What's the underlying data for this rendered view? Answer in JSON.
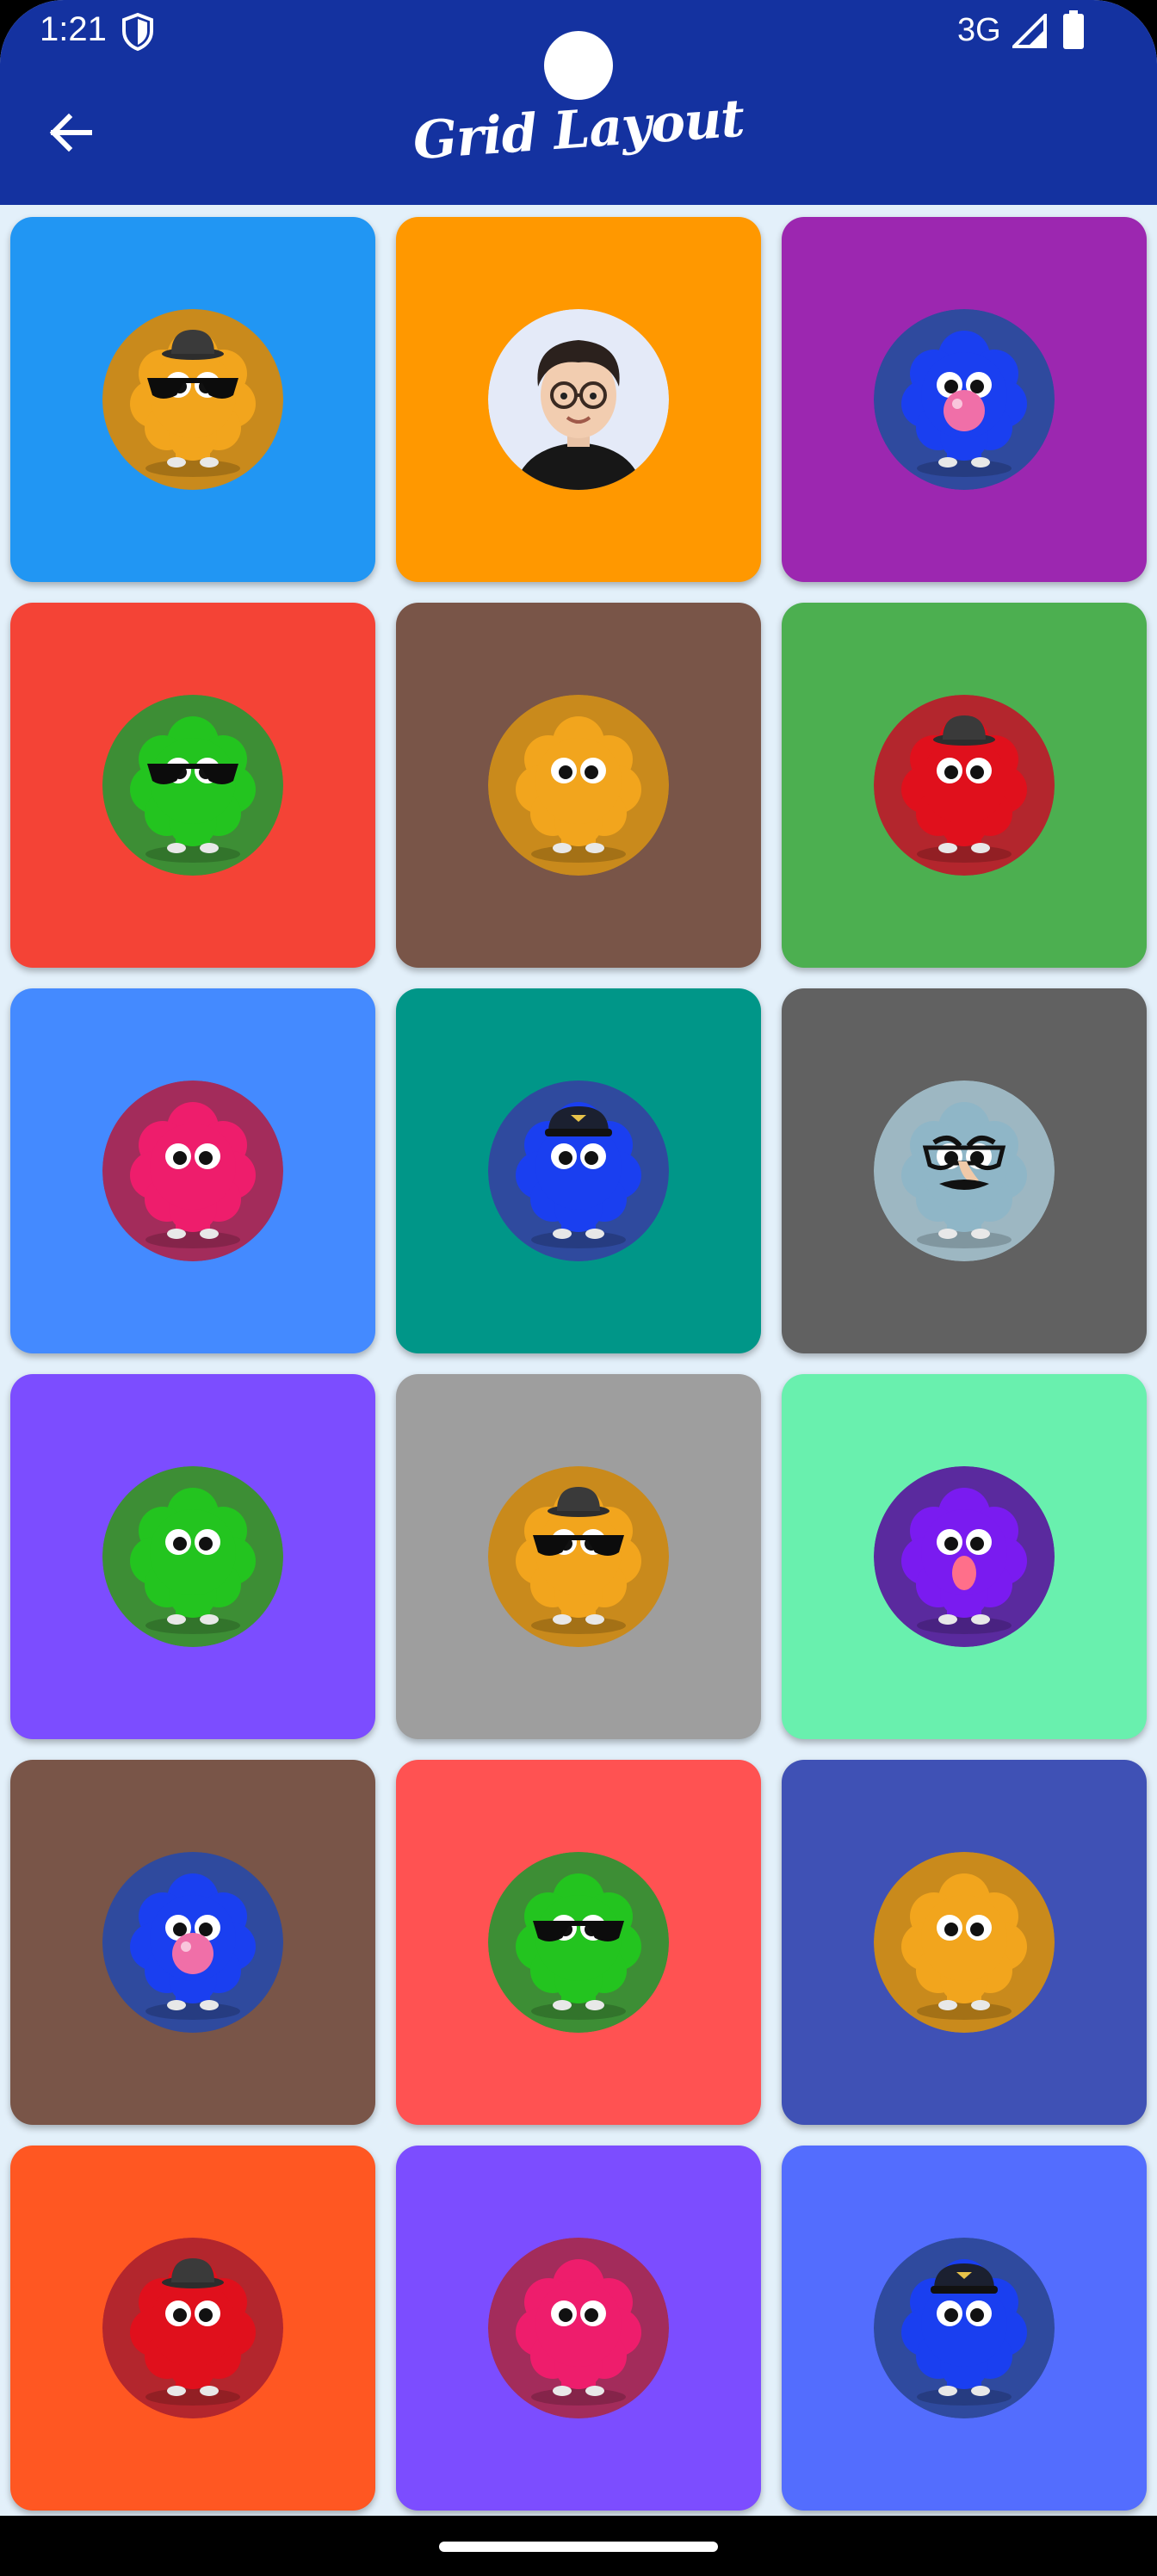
{
  "status_bar": {
    "time": "1:21",
    "network": "3G"
  },
  "app_bar": {
    "title": "Grid Layout"
  },
  "colors": {
    "app_bar": "#1432a0",
    "background": "#e3f0fa"
  },
  "grid": {
    "columns": 3,
    "cards": [
      {
        "bg": "#2196f3",
        "avatar": "monster",
        "fur": "#f2a51d",
        "skin": "#c98a1c",
        "accessory": "hat-glasses"
      },
      {
        "bg": "#ff9800",
        "avatar": "person",
        "fur": "#2b211d",
        "skin": "#e4eaf8",
        "accessory": "glasses"
      },
      {
        "bg": "#9c27b0",
        "avatar": "monster",
        "fur": "#1a3ff0",
        "skin": "#2f4a9e",
        "accessory": "bubblegum"
      },
      {
        "bg": "#f44336",
        "avatar": "monster",
        "fur": "#23c41f",
        "skin": "#3d8e35",
        "accessory": "glasses"
      },
      {
        "bg": "#795548",
        "avatar": "monster",
        "fur": "#f2a51d",
        "skin": "#c98a1c",
        "accessory": "none"
      },
      {
        "bg": "#4caf50",
        "avatar": "monster",
        "fur": "#e0101c",
        "skin": "#b3262d",
        "accessory": "hat"
      },
      {
        "bg": "#448aff",
        "avatar": "monster",
        "fur": "#ee1d6c",
        "skin": "#a32c5b",
        "accessory": "none"
      },
      {
        "bg": "#009688",
        "avatar": "monster",
        "fur": "#1a3ff0",
        "skin": "#2f4a9e",
        "accessory": "cap"
      },
      {
        "bg": "#616161",
        "avatar": "monster",
        "fur": "#8fb6c7",
        "skin": "#9db7c2",
        "accessory": "disguise"
      },
      {
        "bg": "#7c4dff",
        "avatar": "monster",
        "fur": "#23c41f",
        "skin": "#3d8e35",
        "accessory": "none"
      },
      {
        "bg": "#9e9e9e",
        "avatar": "monster",
        "fur": "#f2a51d",
        "skin": "#c98a1c",
        "accessory": "hat-glasses"
      },
      {
        "bg": "#69f0ae",
        "avatar": "monster",
        "fur": "#7a1bf0",
        "skin": "#5a2a9e",
        "accessory": "tongue"
      },
      {
        "bg": "#795548",
        "avatar": "monster",
        "fur": "#1a3ff0",
        "skin": "#2f4a9e",
        "accessory": "bubblegum"
      },
      {
        "bg": "#ff5252",
        "avatar": "monster",
        "fur": "#23c41f",
        "skin": "#3d8e35",
        "accessory": "glasses"
      },
      {
        "bg": "#3f51b5",
        "avatar": "monster",
        "fur": "#f2a51d",
        "skin": "#c98a1c",
        "accessory": "none"
      },
      {
        "bg": "#ff5722",
        "avatar": "monster",
        "fur": "#e0101c",
        "skin": "#b3262d",
        "accessory": "hat"
      },
      {
        "bg": "#7c4dff",
        "avatar": "monster",
        "fur": "#ee1d6c",
        "skin": "#a32c5b",
        "accessory": "none"
      },
      {
        "bg": "#536dfe",
        "avatar": "monster",
        "fur": "#1a3ff0",
        "skin": "#2f4a9e",
        "accessory": "cap"
      }
    ]
  }
}
